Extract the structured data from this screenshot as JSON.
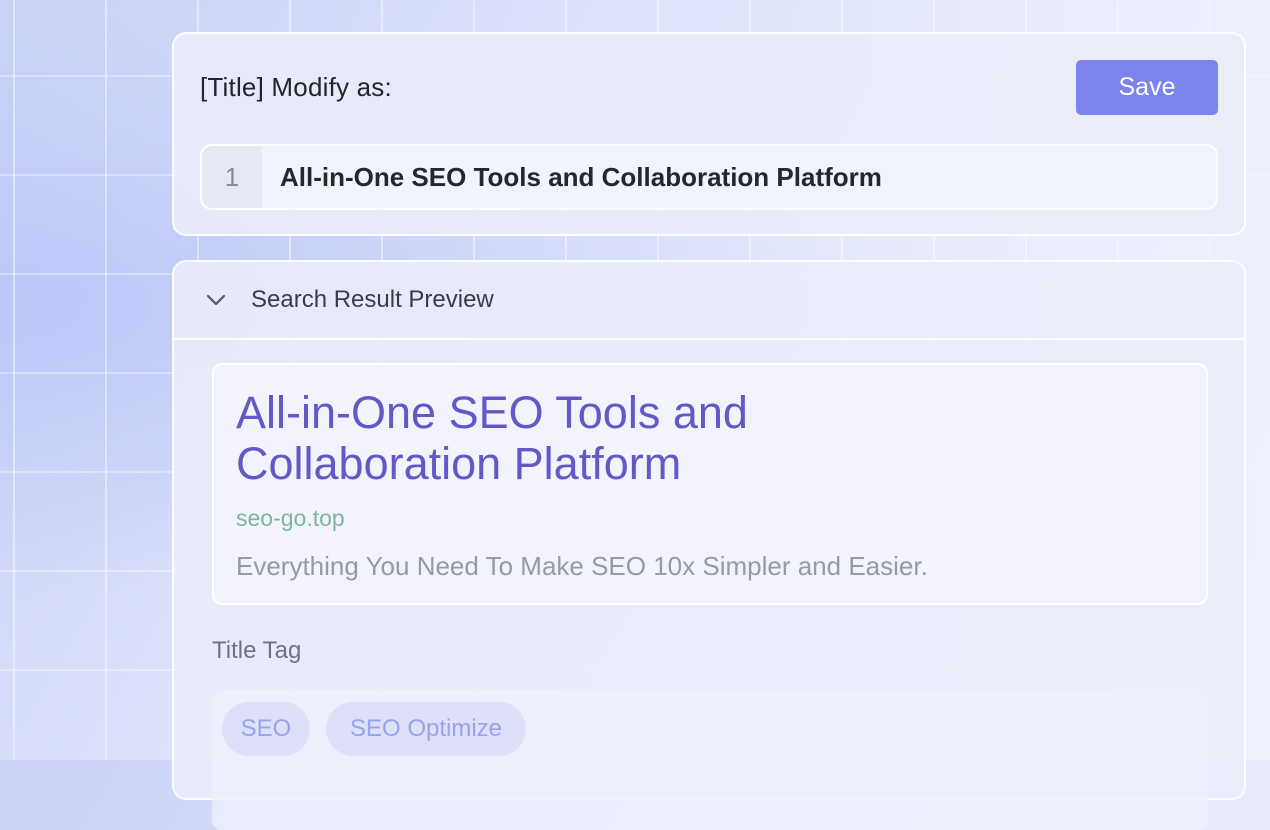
{
  "edit_panel": {
    "heading": "[Title] Modify as:",
    "save_label": "Save",
    "line_number": "1",
    "title_value": "All-in-One SEO Tools and Collaboration Platform"
  },
  "preview_panel": {
    "header": "Search Result Preview",
    "serp": {
      "title": "All-in-One SEO Tools and Collaboration Platform",
      "url": "seo-go.top",
      "description": "Everything You Need To Make SEO 10x Simpler and Easier."
    },
    "tag_label": "Title Tag",
    "tags": [
      "SEO",
      "SEO Optimize"
    ]
  },
  "colors": {
    "accent": "#7c83ec",
    "serp_title": "#6558c6",
    "serp_url": "#7bb89a"
  },
  "icons": {
    "collapse": "chevron-down-icon"
  }
}
